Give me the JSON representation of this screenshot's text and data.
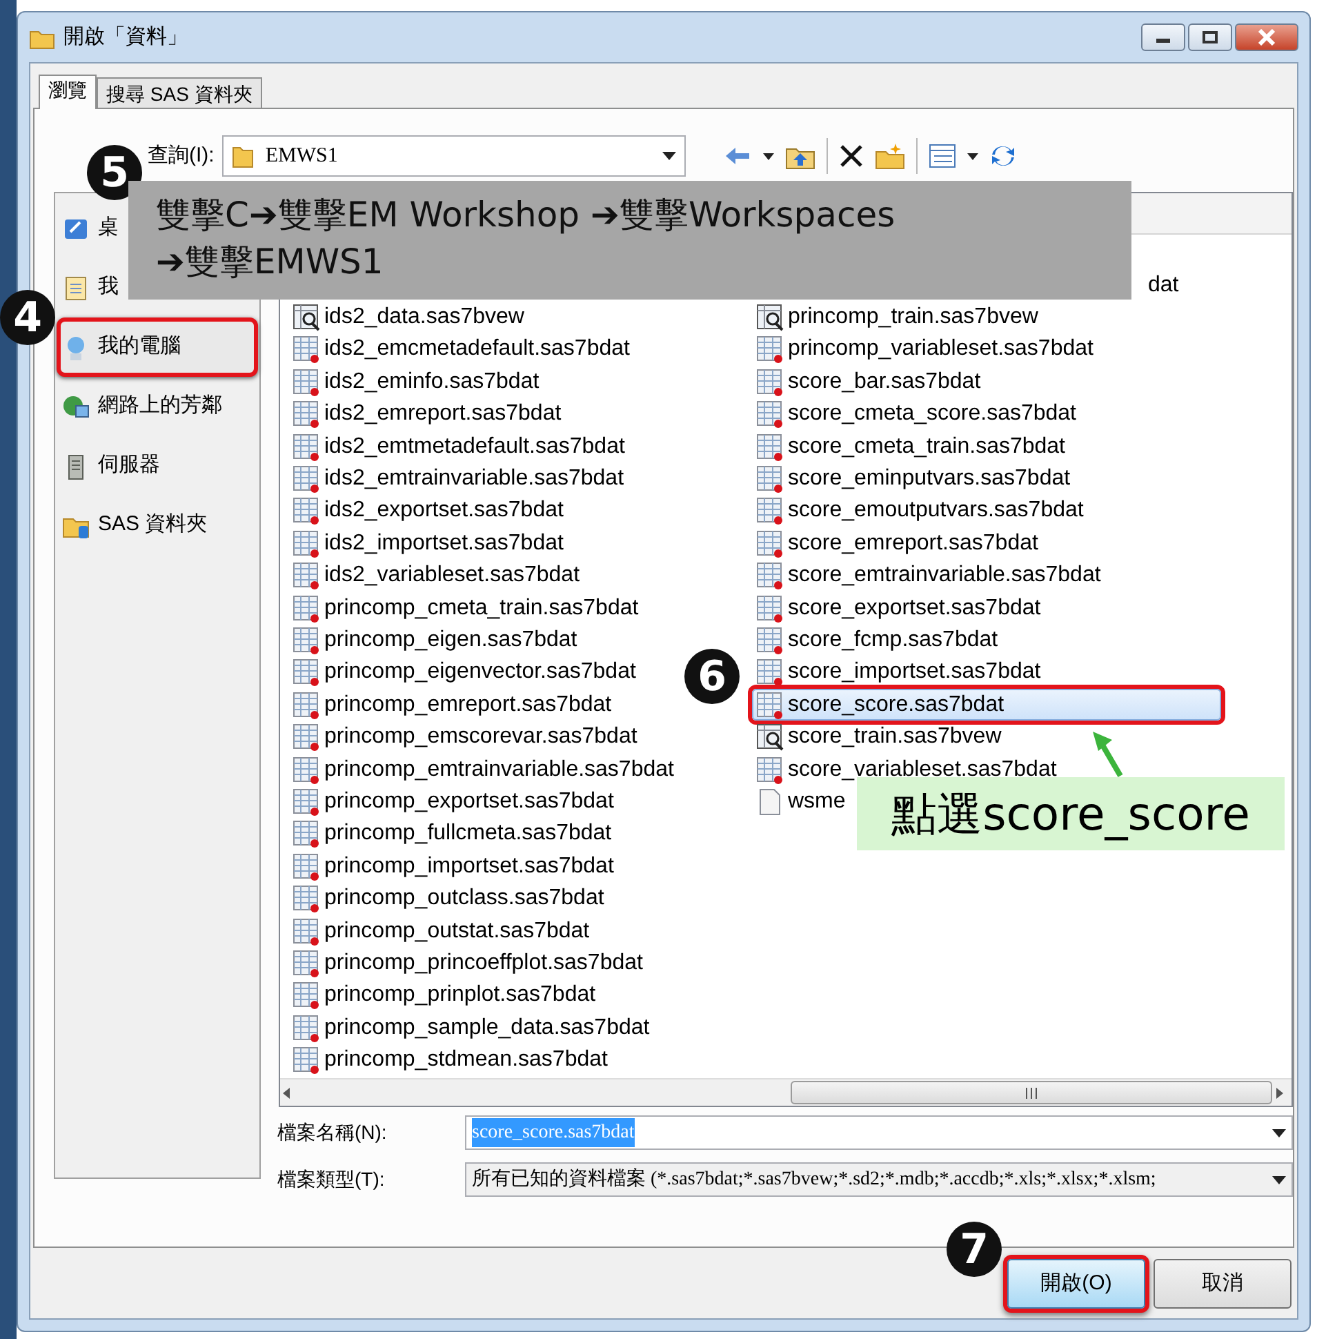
{
  "window": {
    "title": "開啟「資料」"
  },
  "tabs": [
    {
      "label": "瀏覽",
      "selected": true
    },
    {
      "label": "搜尋 SAS 資料夾",
      "selected": false
    }
  ],
  "look_in": {
    "label": "查詢(I):",
    "value": "EMWS1"
  },
  "sidebar": {
    "items": [
      {
        "label": "桌",
        "kind": "desktop",
        "highlighted": false
      },
      {
        "label": "我",
        "kind": "documents",
        "highlighted": false
      },
      {
        "label": "我的電腦",
        "kind": "computer",
        "highlighted": true
      },
      {
        "label": "網路上的芳鄰",
        "kind": "network",
        "highlighted": false
      },
      {
        "label": "伺服器",
        "kind": "server",
        "highlighted": false
      },
      {
        "label": "SAS 資料夾",
        "kind": "sas-folder",
        "highlighted": false
      }
    ]
  },
  "files": {
    "columns": [
      [
        {
          "name": "ids2_data.sas7bvew",
          "kind": "view",
          "selected": false,
          "highlighted": false
        },
        {
          "name": "ids2_emcmetadefault.sas7bdat",
          "kind": "table",
          "selected": false,
          "highlighted": false
        },
        {
          "name": "ids2_eminfo.sas7bdat",
          "kind": "table",
          "selected": false,
          "highlighted": false
        },
        {
          "name": "ids2_emreport.sas7bdat",
          "kind": "table",
          "selected": false,
          "highlighted": false
        },
        {
          "name": "ids2_emtmetadefault.sas7bdat",
          "kind": "table",
          "selected": false,
          "highlighted": false
        },
        {
          "name": "ids2_emtrainvariable.sas7bdat",
          "kind": "table",
          "selected": false,
          "highlighted": false
        },
        {
          "name": "ids2_exportset.sas7bdat",
          "kind": "table",
          "selected": false,
          "highlighted": false
        },
        {
          "name": "ids2_importset.sas7bdat",
          "kind": "table",
          "selected": false,
          "highlighted": false
        },
        {
          "name": "ids2_variableset.sas7bdat",
          "kind": "table",
          "selected": false,
          "highlighted": false
        },
        {
          "name": "princomp_cmeta_train.sas7bdat",
          "kind": "table",
          "selected": false,
          "highlighted": false
        },
        {
          "name": "princomp_eigen.sas7bdat",
          "kind": "table",
          "selected": false,
          "highlighted": false
        },
        {
          "name": "princomp_eigenvector.sas7bdat",
          "kind": "table",
          "selected": false,
          "highlighted": false
        },
        {
          "name": "princomp_emreport.sas7bdat",
          "kind": "table",
          "selected": false,
          "highlighted": false
        },
        {
          "name": "princomp_emscorevar.sas7bdat",
          "kind": "table",
          "selected": false,
          "highlighted": false
        },
        {
          "name": "princomp_emtrainvariable.sas7bdat",
          "kind": "table",
          "selected": false,
          "highlighted": false
        },
        {
          "name": "princomp_exportset.sas7bdat",
          "kind": "table",
          "selected": false,
          "highlighted": false
        },
        {
          "name": "princomp_fullcmeta.sas7bdat",
          "kind": "table",
          "selected": false,
          "highlighted": false
        },
        {
          "name": "princomp_importset.sas7bdat",
          "kind": "table",
          "selected": false,
          "highlighted": false
        },
        {
          "name": "princomp_outclass.sas7bdat",
          "kind": "table",
          "selected": false,
          "highlighted": false
        },
        {
          "name": "princomp_outstat.sas7bdat",
          "kind": "table",
          "selected": false,
          "highlighted": false
        },
        {
          "name": "princomp_princoeffplot.sas7bdat",
          "kind": "table",
          "selected": false,
          "highlighted": false
        },
        {
          "name": "princomp_prinplot.sas7bdat",
          "kind": "table",
          "selected": false,
          "highlighted": false
        },
        {
          "name": "princomp_sample_data.sas7bdat",
          "kind": "table",
          "selected": false,
          "highlighted": false
        },
        {
          "name": "princomp_stdmean.sas7bdat",
          "kind": "table",
          "selected": false,
          "highlighted": false
        }
      ],
      [
        {
          "name": "dat",
          "kind": "partial",
          "selected": false,
          "highlighted": false
        },
        {
          "name": "princomp_train.sas7bvew",
          "kind": "view",
          "selected": false,
          "highlighted": false
        },
        {
          "name": "princomp_variableset.sas7bdat",
          "kind": "table",
          "selected": false,
          "highlighted": false
        },
        {
          "name": "score_bar.sas7bdat",
          "kind": "table",
          "selected": false,
          "highlighted": false
        },
        {
          "name": "score_cmeta_score.sas7bdat",
          "kind": "table",
          "selected": false,
          "highlighted": false
        },
        {
          "name": "score_cmeta_train.sas7bdat",
          "kind": "table",
          "selected": false,
          "highlighted": false
        },
        {
          "name": "score_eminputvars.sas7bdat",
          "kind": "table",
          "selected": false,
          "highlighted": false
        },
        {
          "name": "score_emoutputvars.sas7bdat",
          "kind": "table",
          "selected": false,
          "highlighted": false
        },
        {
          "name": "score_emreport.sas7bdat",
          "kind": "table",
          "selected": false,
          "highlighted": false
        },
        {
          "name": "score_emtrainvariable.sas7bdat",
          "kind": "table",
          "selected": false,
          "highlighted": false
        },
        {
          "name": "score_exportset.sas7bdat",
          "kind": "table",
          "selected": false,
          "highlighted": false
        },
        {
          "name": "score_fcmp.sas7bdat",
          "kind": "table",
          "selected": false,
          "highlighted": false
        },
        {
          "name": "score_importset.sas7bdat",
          "kind": "table",
          "selected": false,
          "highlighted": false
        },
        {
          "name": "score_score.sas7bdat",
          "kind": "table",
          "selected": true,
          "highlighted": true
        },
        {
          "name": "score_train.sas7bvew",
          "kind": "view",
          "selected": false,
          "highlighted": false
        },
        {
          "name": "score_variableset.sas7bdat",
          "kind": "table",
          "selected": false,
          "highlighted": false
        },
        {
          "name": "wsme",
          "kind": "document",
          "selected": false,
          "highlighted": false
        }
      ]
    ]
  },
  "file_name": {
    "label": "檔案名稱(N):",
    "value": "score_score.sas7bdat",
    "text_selected": true
  },
  "file_type": {
    "label": "檔案類型(T):",
    "value": "所有已知的資料檔案 (*.sas7bdat;*.sas7bvew;*.sd2;*.mdb;*.accdb;*.xls;*.xlsx;*.xlsm;"
  },
  "buttons": [
    {
      "label": "開啟(O)",
      "kind": "default",
      "highlighted": true
    },
    {
      "label": "取消",
      "kind": "normal",
      "highlighted": false
    }
  ],
  "annotations": {
    "steps": [
      "5",
      "4",
      "6",
      "7"
    ],
    "instruction": "雙擊C➔雙擊EM Workshop ➔雙擊Workspaces ➔雙擊EMWS1",
    "callout": "點選score_score"
  }
}
